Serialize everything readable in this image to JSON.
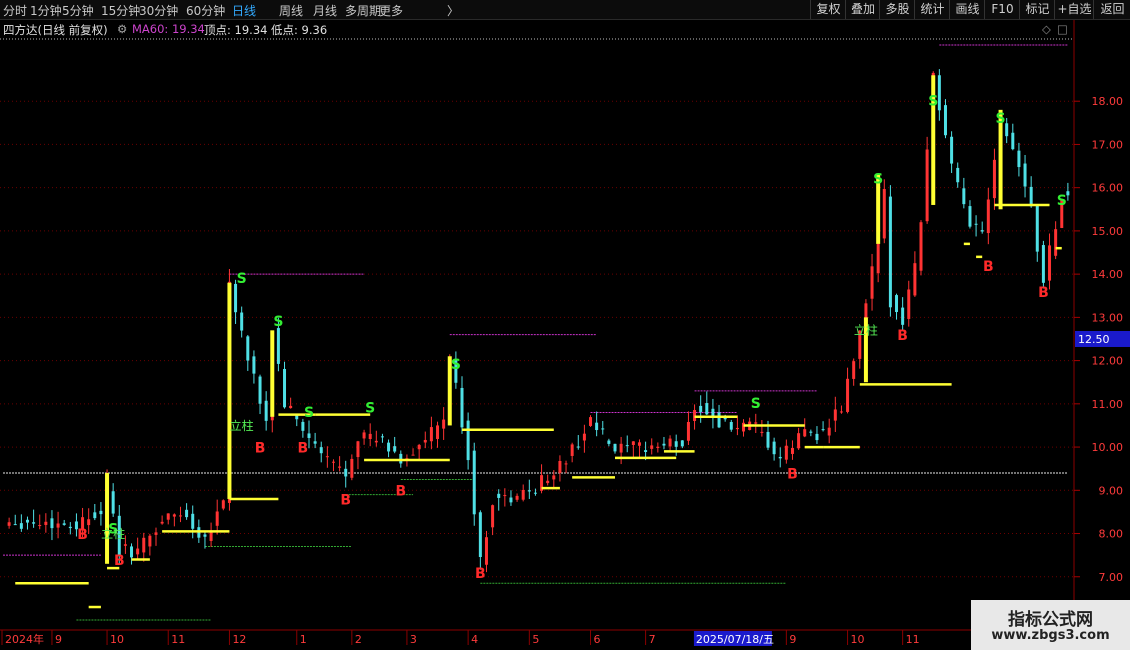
{
  "toolbar": {
    "periods": [
      "分时",
      "1分钟",
      "5分钟",
      "15分钟",
      "30分钟",
      "60分钟",
      "日线",
      "周线",
      "月线",
      "多周期",
      "更多"
    ],
    "active_period": "日线",
    "more_arrow": "〉",
    "tools": [
      "复权",
      "叠加",
      "多股",
      "统计",
      "画线",
      "F10",
      "标记",
      "+自选",
      "返回"
    ]
  },
  "infobar": {
    "title": "四方达(日线 前复权)",
    "ma_label": "MA60: 19.34",
    "top_label": "顶点: 19.34",
    "low_label": "低点: 9.36",
    "close_icon": "◇",
    "window_icon": "□"
  },
  "chart_data": {
    "type": "candlestick",
    "ylim": [
      6.0,
      19.3
    ],
    "y_ticks": [
      "7.00",
      "8.00",
      "9.00",
      "10.00",
      "11.00",
      "12.00",
      "13.00",
      "14.00",
      "15.00",
      "16.00",
      "17.00",
      "18.00"
    ],
    "y_tick_values": [
      7,
      8,
      9,
      10,
      11,
      12,
      13,
      14,
      15,
      16,
      17,
      18
    ],
    "current_price": "12.50",
    "current_price_value": 12.5,
    "x_axis_labels": [
      {
        "label": "2024年",
        "bar": 0
      },
      {
        "label": "9",
        "bar": 8
      },
      {
        "label": "10",
        "bar": 17
      },
      {
        "label": "11",
        "bar": 27
      },
      {
        "label": "12",
        "bar": 37
      },
      {
        "label": "1",
        "bar": 48
      },
      {
        "label": "2",
        "bar": 57
      },
      {
        "label": "3",
        "bar": 66
      },
      {
        "label": "4",
        "bar": 76
      },
      {
        "label": "5",
        "bar": 86
      },
      {
        "label": "6",
        "bar": 96
      },
      {
        "label": "7",
        "bar": 105
      },
      {
        "label": "9",
        "bar": 128
      },
      {
        "label": "10",
        "bar": 138
      },
      {
        "label": "11",
        "bar": 147
      }
    ],
    "crosshair_date": "2025/07/18/五",
    "crosshair_bar": 116,
    "anchors": [
      [
        0,
        8.3
      ],
      [
        6,
        8.25
      ],
      [
        12,
        8.2
      ],
      [
        16,
        8.6
      ],
      [
        17,
        9.1
      ],
      [
        19,
        7.6
      ],
      [
        22,
        7.6
      ],
      [
        26,
        8.3
      ],
      [
        29,
        8.5
      ],
      [
        33,
        7.9
      ],
      [
        36,
        8.8
      ],
      [
        37,
        13.8
      ],
      [
        40,
        12.0
      ],
      [
        43,
        10.6
      ],
      [
        44,
        12.7
      ],
      [
        46,
        11.0
      ],
      [
        48,
        10.6
      ],
      [
        52,
        9.8
      ],
      [
        56,
        9.4
      ],
      [
        58,
        10.3
      ],
      [
        62,
        10.1
      ],
      [
        65,
        9.7
      ],
      [
        68,
        10.0
      ],
      [
        72,
        10.6
      ],
      [
        73,
        12.1
      ],
      [
        76,
        9.8
      ],
      [
        78,
        7.3
      ],
      [
        80,
        8.8
      ],
      [
        84,
        8.8
      ],
      [
        88,
        9.2
      ],
      [
        92,
        9.7
      ],
      [
        96,
        10.6
      ],
      [
        100,
        9.9
      ],
      [
        105,
        10.0
      ],
      [
        111,
        10.1
      ],
      [
        113,
        11.0
      ],
      [
        118,
        10.5
      ],
      [
        123,
        10.4
      ],
      [
        127,
        9.7
      ],
      [
        131,
        10.4
      ],
      [
        134,
        10.3
      ],
      [
        137,
        10.9
      ],
      [
        140,
        12.6
      ],
      [
        143,
        14.8
      ],
      [
        144,
        15.8
      ],
      [
        145,
        13.4
      ],
      [
        147,
        13.0
      ],
      [
        149,
        14.2
      ],
      [
        150,
        15.3
      ],
      [
        152,
        18.6
      ],
      [
        155,
        16.4
      ],
      [
        158,
        15.2
      ],
      [
        160,
        15.0
      ],
      [
        163,
        17.6
      ],
      [
        166,
        16.6
      ],
      [
        168,
        15.5
      ],
      [
        169,
        14.6
      ],
      [
        170,
        13.9
      ],
      [
        173,
        15.8
      ]
    ],
    "buy_markers": [
      {
        "label": "B",
        "bar": 13,
        "price": 8.2
      },
      {
        "label": "B",
        "bar": 19,
        "price": 7.6
      },
      {
        "label": "B",
        "bar": 42,
        "price": 10.2
      },
      {
        "label": "B",
        "bar": 49,
        "price": 10.2
      },
      {
        "label": "B",
        "bar": 56,
        "price": 9.0
      },
      {
        "label": "B",
        "bar": 65,
        "price": 9.2
      },
      {
        "label": "B",
        "bar": 78,
        "price": 7.3
      },
      {
        "label": "B",
        "bar": 129,
        "price": 9.6
      },
      {
        "label": "B",
        "bar": 147,
        "price": 12.8
      },
      {
        "label": "B",
        "bar": 161,
        "price": 14.4
      },
      {
        "label": "B",
        "bar": 170,
        "price": 13.8
      }
    ],
    "sell_markers": [
      {
        "label": "S",
        "bar": 18,
        "price": 8.0
      },
      {
        "label": "S",
        "bar": 39,
        "price": 13.8
      },
      {
        "label": "S",
        "bar": 45,
        "price": 12.8
      },
      {
        "label": "S",
        "bar": 50,
        "price": 10.7
      },
      {
        "label": "S",
        "bar": 60,
        "price": 10.8
      },
      {
        "label": "S",
        "bar": 74,
        "price": 11.8
      },
      {
        "label": "S",
        "bar": 123,
        "price": 10.9
      },
      {
        "label": "S",
        "bar": 143,
        "price": 16.1
      },
      {
        "label": "S",
        "bar": 152,
        "price": 17.9
      },
      {
        "label": "S",
        "bar": 163,
        "price": 17.5
      },
      {
        "label": "S",
        "bar": 173,
        "price": 15.6
      }
    ],
    "text_markers": [
      {
        "label": "立柱",
        "bar": 18,
        "price": 7.9
      },
      {
        "label": "立柱",
        "bar": 39,
        "price": 10.4
      },
      {
        "label": "立柱",
        "bar": 141,
        "price": 12.6
      }
    ],
    "yellow_bars": [
      {
        "bar": 17,
        "low": 7.3,
        "high": 9.4
      },
      {
        "bar": 37,
        "low": 8.8,
        "high": 13.8
      },
      {
        "bar": 44,
        "low": 10.7,
        "high": 12.7
      },
      {
        "bar": 73,
        "low": 10.5,
        "high": 12.1
      },
      {
        "bar": 141,
        "low": 11.5,
        "high": 13.0
      },
      {
        "bar": 143,
        "low": 14.7,
        "high": 16.3
      },
      {
        "bar": 152,
        "low": 15.6,
        "high": 18.6
      },
      {
        "bar": 163,
        "low": 15.5,
        "high": 17.8
      }
    ],
    "yellow_levels": [
      {
        "from": 2,
        "to": 14,
        "price": 6.85
      },
      {
        "from": 14,
        "to": 16,
        "price": 6.3
      },
      {
        "from": 17,
        "to": 19,
        "price": 7.2
      },
      {
        "from": 21,
        "to": 24,
        "price": 7.4
      },
      {
        "from": 26,
        "to": 37,
        "price": 8.05
      },
      {
        "from": 37,
        "to": 45,
        "price": 8.8
      },
      {
        "from": 45,
        "to": 51,
        "price": 10.75
      },
      {
        "from": 51,
        "to": 60,
        "price": 10.75
      },
      {
        "from": 59,
        "to": 73,
        "price": 9.7
      },
      {
        "from": 75,
        "to": 90,
        "price": 10.4
      },
      {
        "from": 88,
        "to": 91,
        "price": 9.05
      },
      {
        "from": 93,
        "to": 100,
        "price": 9.3
      },
      {
        "from": 100,
        "to": 110,
        "price": 9.75
      },
      {
        "from": 108,
        "to": 113,
        "price": 9.9
      },
      {
        "from": 113,
        "to": 120,
        "price": 10.7
      },
      {
        "from": 121,
        "to": 131,
        "price": 10.5
      },
      {
        "from": 131,
        "to": 134,
        "price": 10.0
      },
      {
        "from": 134,
        "to": 140,
        "price": 10.0
      },
      {
        "from": 140,
        "to": 155,
        "price": 11.45
      },
      {
        "from": 157,
        "to": 158,
        "price": 14.7
      },
      {
        "from": 159,
        "to": 160,
        "price": 14.4
      },
      {
        "from": 162,
        "to": 171,
        "price": 15.6
      },
      {
        "from": 172,
        "to": 173,
        "price": 14.6
      }
    ],
    "magenta_levels": [
      {
        "from": 0,
        "to": 16,
        "price": 7.5
      },
      {
        "from": 37,
        "to": 59,
        "price": 14.0
      },
      {
        "from": 73,
        "to": 97,
        "price": 12.6
      },
      {
        "from": 96,
        "to": 120,
        "price": 10.8
      },
      {
        "from": 113,
        "to": 133,
        "price": 11.3
      },
      {
        "from": 153,
        "to": 174,
        "price": 19.3
      }
    ],
    "green_levels": [
      {
        "from": 12,
        "to": 34,
        "price": 6.0
      },
      {
        "from": 33,
        "to": 57,
        "price": 7.7
      },
      {
        "from": 56,
        "to": 67,
        "price": 8.9
      },
      {
        "from": 65,
        "to": 77,
        "price": 9.25
      },
      {
        "from": 78,
        "to": 128,
        "price": 6.85
      }
    ],
    "white_level": {
      "price": 9.4,
      "from": 0,
      "to": 174
    },
    "colors": {
      "up": "#ff3333",
      "down": "#4fe0e6",
      "yellow": "#ffff33",
      "magenta": "#cc33cc",
      "green": "#33aa33",
      "grid": "#6a0000",
      "axis_text": "#ff3b3b",
      "buy": "#ff2a2a",
      "sell": "#33ee33"
    }
  },
  "watermark": {
    "line1": "指标公式网",
    "line2": "www.zbgs3.com"
  }
}
